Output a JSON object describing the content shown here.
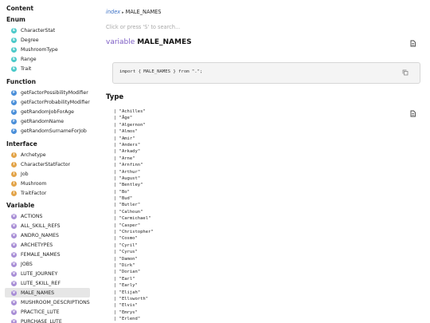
{
  "sidebar": {
    "groups": [
      {
        "title": "Content",
        "items": []
      },
      {
        "title": "Enum",
        "icon": "E",
        "items": [
          "CharacterStat",
          "Degree",
          "MushroomType",
          "Range",
          "Trait"
        ]
      },
      {
        "title": "Function",
        "icon": "F",
        "items": [
          "getFactorPossibilityModifier",
          "getFactorProbabilityModifier",
          "getRandomJobForAge",
          "getRandomName",
          "getRandomSurnameForJob"
        ]
      },
      {
        "title": "Interface",
        "icon": "I",
        "items": [
          "Archetype",
          "CharacterStatFactor",
          "Job",
          "Mushroom",
          "TraitFactor"
        ]
      },
      {
        "title": "Variable",
        "icon": "V",
        "items": [
          "ACTIONS",
          "ALL_SKILL_REFS",
          "ANDRO_NAMES",
          "ARCHETYPES",
          "FEMALE_NAMES",
          "JOBS",
          "LUTE_JOURNEY",
          "LUTE_SKILL_REF",
          "MALE_NAMES",
          "MUSHROOM_DESCRIPTIONS",
          "PRACTICE_LUTE",
          "PURCHASE_LUTE"
        ]
      }
    ],
    "active": "MALE_NAMES"
  },
  "breadcrumb": {
    "link": "index",
    "separator": "▸",
    "current": "MALE_NAMES"
  },
  "search": {
    "placeholder": "Click or press 'S' to search..."
  },
  "header": {
    "keyword": "variable",
    "name": "MALE_NAMES"
  },
  "code": {
    "import": "import { MALE_NAMES } from \".\";"
  },
  "type": {
    "heading": "Type",
    "names": [
      "Achilles",
      "Åge",
      "Algernon",
      "Almos",
      "Amir",
      "Anders",
      "Arkady",
      "Arne",
      "Arnfinn",
      "Arthur",
      "August",
      "Bentley",
      "Bo",
      "Bud",
      "Butler",
      "Calhoun",
      "Carmichael",
      "Casper",
      "Christopher",
      "Cosmo",
      "Cyril",
      "Cyrus",
      "Damon",
      "Dirk",
      "Dorian",
      "Earl",
      "Early",
      "Elijah",
      "Ellsworth",
      "Elvis",
      "Emrys",
      "Erlend"
    ]
  },
  "icons": {
    "doc": "document-icon",
    "copy": "copy-icon"
  }
}
